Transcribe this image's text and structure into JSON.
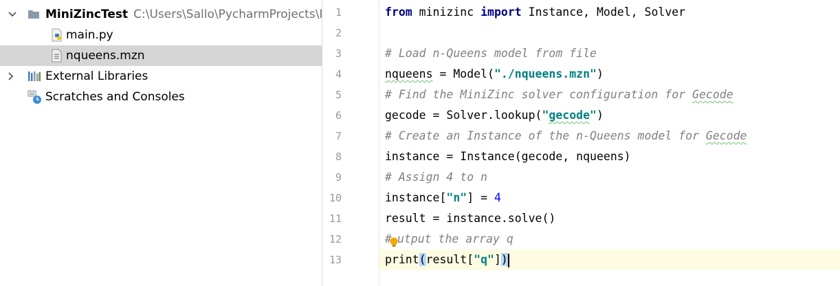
{
  "project_tree": {
    "root": {
      "name": "MiniZincTest",
      "path": "C:\\Users\\Sallo\\PycharmProjects\\Mini"
    },
    "files": [
      {
        "label": "main.py",
        "icon": "python-file-icon"
      },
      {
        "label": "nqueens.mzn",
        "icon": "text-file-icon",
        "selected": true
      }
    ],
    "external_libraries": "External Libraries",
    "scratches": "Scratches and Consoles"
  },
  "editor": {
    "line_numbers": [
      "1",
      "2",
      "3",
      "4",
      "5",
      "6",
      "7",
      "8",
      "9",
      "10",
      "11",
      "12",
      "13"
    ],
    "current_line": 13,
    "lines": [
      [
        {
          "t": "from",
          "c": "kw"
        },
        {
          "t": " minizinc ",
          "c": "plain"
        },
        {
          "t": "import",
          "c": "kw"
        },
        {
          "t": " Instance, Model, Solver",
          "c": "plain"
        }
      ],
      [],
      [
        {
          "t": "# Load n-Queens model from file",
          "c": "cmt"
        }
      ],
      [
        {
          "t": "nqueens",
          "c": "plain squiggle"
        },
        {
          "t": " = Model(",
          "c": "plain"
        },
        {
          "t": "\"./nqueens.mzn\"",
          "c": "str"
        },
        {
          "t": ")",
          "c": "plain"
        }
      ],
      [
        {
          "t": "# Find the MiniZinc solver configuration for ",
          "c": "cmt"
        },
        {
          "t": "Gecode",
          "c": "cmt squiggle"
        }
      ],
      [
        {
          "t": "gecode = Solver.lookup(",
          "c": "plain"
        },
        {
          "t": "\"",
          "c": "str"
        },
        {
          "t": "gecode",
          "c": "str squiggle"
        },
        {
          "t": "\"",
          "c": "str"
        },
        {
          "t": ")",
          "c": "plain"
        }
      ],
      [
        {
          "t": "# Create an Instance of the n-Queens model for ",
          "c": "cmt"
        },
        {
          "t": "Gecode",
          "c": "cmt squiggle"
        }
      ],
      [
        {
          "t": "instance = Instance(gecode, nqueens)",
          "c": "plain"
        }
      ],
      [
        {
          "t": "# Assign 4 to n",
          "c": "cmt"
        }
      ],
      [
        {
          "t": "instance[",
          "c": "plain"
        },
        {
          "t": "\"n\"",
          "c": "str"
        },
        {
          "t": "] = ",
          "c": "plain"
        },
        {
          "t": "4",
          "c": "num"
        }
      ],
      [
        {
          "t": "result = instance.solve()",
          "c": "plain"
        }
      ],
      [
        {
          "t": "#",
          "c": "cmt"
        },
        {
          "t": "BULB",
          "c": "bulb"
        },
        {
          "t": "utput the array q",
          "c": "cmt"
        }
      ],
      [
        {
          "t": "print",
          "c": "plain"
        },
        {
          "t": "(",
          "c": "plain bracket-hl"
        },
        {
          "t": "result[",
          "c": "plain"
        },
        {
          "t": "\"q\"",
          "c": "str"
        },
        {
          "t": "]",
          "c": "plain"
        },
        {
          "t": ")",
          "c": "plain bracket-hl"
        },
        {
          "t": "CARET",
          "c": "caret"
        }
      ]
    ]
  }
}
